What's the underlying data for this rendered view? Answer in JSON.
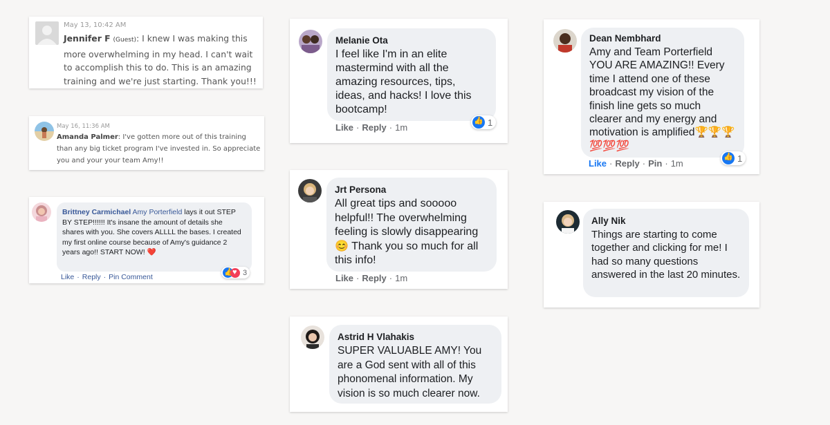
{
  "colors": {
    "background": "#f7f6f5",
    "bubble": "#eef0f3",
    "fb_blue": "#1877f2",
    "link_blue": "#385898",
    "meta_gray": "#9a9a9a"
  },
  "comments": [
    {
      "timestamp": "May 13, 10:42 AM",
      "name": "Jennifer F",
      "guest_tag": "(Guest)",
      "text": ": I knew I was making this more overwhelming in my head. I can't wait to accomplish this to do. This is an amazing training and we're just starting. Thank you!!!",
      "avatar": "default-user-icon"
    },
    {
      "timestamp": "May 16, 11:36 AM",
      "name": "Amanda Palmer",
      "text": ": I've gotten more out of this training than any big ticket program I've invested in. So appreciate you and your your team Amy!!",
      "avatar": "beach-photo"
    },
    {
      "name": "Brittney Carmichael",
      "mention": "Amy Porterfield",
      "text": " lays it out STEP BY STEP!!!!!! It's insane the amount of details she shares with you. She covers ALLLL the bases. I created my first online course because of Amy's guidance 2 years ago!! START NOW! ❤️",
      "actions": [
        "Like",
        "Reply",
        "Pin Comment"
      ],
      "reaction_count": "3"
    },
    {
      "name": "Melanie Ota",
      "text": "I feel like I'm in an elite mastermind with all the amazing resources, tips, ideas, and hacks! I love this bootcamp!",
      "actions": [
        "Like",
        "Reply"
      ],
      "time": "1m",
      "reaction_count": "1"
    },
    {
      "name": "Jrt Persona",
      "text": "All great tips and sooooo helpful!! The overwhelming feeling is slowly disappearing 😊 Thank you so much for all this info!",
      "actions": [
        "Like",
        "Reply"
      ],
      "time": "1m"
    },
    {
      "name": "Astrid H Vlahakis",
      "text": "SUPER VALUABLE AMY! You are a God sent with all of this phonomenal information. My vision is so much clearer now."
    },
    {
      "name": "Dean Nembhard",
      "text": "Amy and Team Porterfield YOU ARE AMAZING!! Every time I attend one of these broadcast my vision of the finish line gets so much clearer and my energy and motivation is amplified🏆🏆🏆 💯💯💯",
      "actions": [
        "Like",
        "Reply",
        "Pin"
      ],
      "time": "1m",
      "reaction_count": "1"
    },
    {
      "name": "Ally Nik",
      "text": "Things are starting to come together and clicking for me! I had so many questions answered in the last 20 minutes."
    }
  ]
}
